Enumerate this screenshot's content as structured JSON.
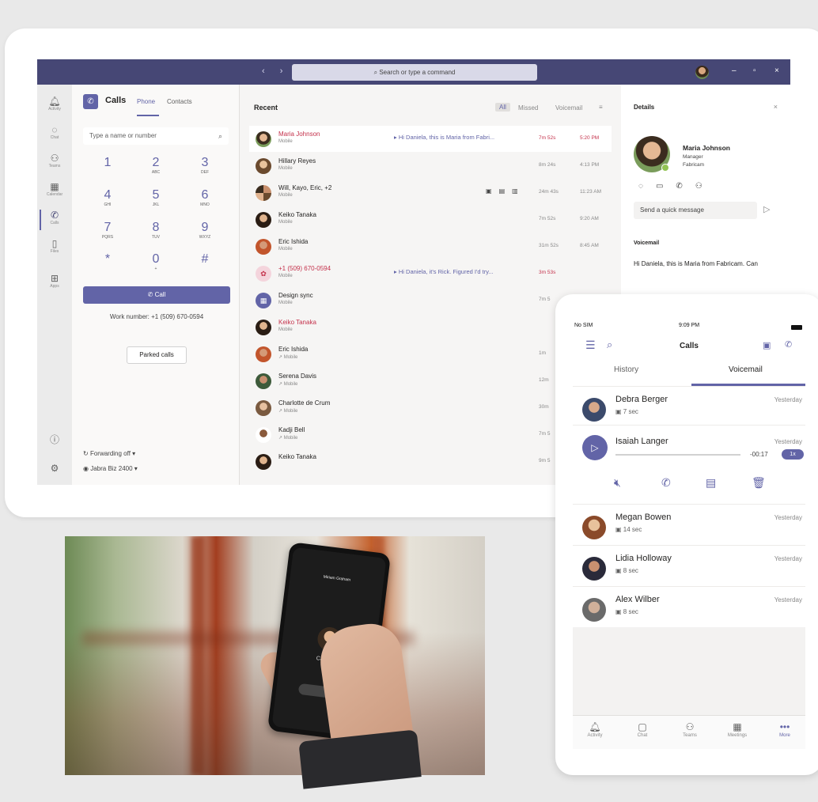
{
  "desktop": {
    "search": {
      "placeholder": "Search or type a command"
    },
    "nav_arrows": "‹  ›",
    "window_controls": {
      "minimize": "–",
      "maximize": "▫",
      "close": "×"
    },
    "rail": [
      {
        "label": "Activity",
        "icon": "bell-icon"
      },
      {
        "label": "Chat",
        "icon": "chat-icon"
      },
      {
        "label": "Teams",
        "icon": "teams-icon"
      },
      {
        "label": "Calendar",
        "icon": "calendar-icon"
      },
      {
        "label": "Calls",
        "icon": "phone-icon"
      },
      {
        "label": "Files",
        "icon": "file-icon"
      },
      {
        "label": "Apps",
        "icon": "apps-icon"
      }
    ],
    "dialer": {
      "title": "Calls",
      "tab_phone": "Phone",
      "tab_contacts": "Contacts",
      "input_placeholder": "Type a name or number",
      "keys": [
        {
          "d": "1",
          "l": ""
        },
        {
          "d": "2",
          "l": "ABC"
        },
        {
          "d": "3",
          "l": "DEF"
        },
        {
          "d": "4",
          "l": "GHI"
        },
        {
          "d": "5",
          "l": "JKL"
        },
        {
          "d": "6",
          "l": "MNO"
        },
        {
          "d": "7",
          "l": "PQRS"
        },
        {
          "d": "8",
          "l": "TUV"
        },
        {
          "d": "9",
          "l": "WXYZ"
        },
        {
          "d": "*",
          "l": ""
        },
        {
          "d": "0",
          "l": "+"
        },
        {
          "d": "#",
          "l": ""
        }
      ],
      "call_label": "Call",
      "work_number": "Work number: +1 (509) 670-0594",
      "parked_calls": "Parked calls",
      "forwarding": "Forwarding off",
      "device": "Jabra Biz 2400"
    },
    "recent": {
      "title": "Recent",
      "filters": [
        "All",
        "Missed",
        "Voicemail"
      ],
      "rows": [
        {
          "name": "Maria Johnson",
          "sub": "Mobile",
          "snippet": "Hi Daniela, this is Maria from Fabri...",
          "duration": "7m 52s",
          "time": "5:20 PM",
          "missed": true
        },
        {
          "name": "Hillary Reyes",
          "sub": "Mobile",
          "snippet": "",
          "duration": "8m 24s",
          "time": "4:13 PM",
          "missed": false
        },
        {
          "name": "Will, Kayo, Eric, +2",
          "sub": "Mobile",
          "snippet": "",
          "duration": "24m 43s",
          "time": "11:23 AM",
          "missed": false
        },
        {
          "name": "Keiko Tanaka",
          "sub": "Mobile",
          "snippet": "",
          "duration": "7m 52s",
          "time": "9:20 AM",
          "missed": false
        },
        {
          "name": "Eric Ishida",
          "sub": "Mobile",
          "snippet": "",
          "duration": "31m 52s",
          "time": "8:45 AM",
          "missed": false
        },
        {
          "name": "+1 (509) 670-0594",
          "sub": "Mobile",
          "snippet": "Hi Daniela, it's Rick. Figured I'd try...",
          "duration": "3m 53s",
          "time": "",
          "missed": true
        },
        {
          "name": "Design sync",
          "sub": "Mobile",
          "snippet": "",
          "duration": "7m 5",
          "time": "",
          "missed": false
        },
        {
          "name": "Keiko Tanaka",
          "sub": "Mobile",
          "snippet": "",
          "duration": "",
          "time": "",
          "missed": true
        },
        {
          "name": "Eric Ishida",
          "sub": "↗ Mobile",
          "snippet": "",
          "duration": "1m",
          "time": "",
          "missed": false
        },
        {
          "name": "Serena Davis",
          "sub": "↗ Mobile",
          "snippet": "",
          "duration": "12m",
          "time": "",
          "missed": false
        },
        {
          "name": "Charlotte de Crum",
          "sub": "↗ Mobile",
          "snippet": "",
          "duration": "30m",
          "time": "",
          "missed": false
        },
        {
          "name": "Kadji Bell",
          "sub": "↗ Mobile",
          "snippet": "",
          "duration": "7m 5",
          "time": "",
          "missed": false
        },
        {
          "name": "Keiko Tanaka",
          "sub": "",
          "snippet": "",
          "duration": "9m 5",
          "time": "",
          "missed": false
        }
      ]
    },
    "details": {
      "title": "Details",
      "name": "Maria Johnson",
      "role": "Manager",
      "org": "Fabricam",
      "quick_message": "Send a quick message",
      "voicemail_label": "Voicemail",
      "voicemail_text": "Hi Daniela, this is Maria from Fabricam. Can"
    }
  },
  "photo_phone": {
    "header": "Miriam Graham",
    "calling": "Calling..."
  },
  "mobile": {
    "carrier": "No SIM",
    "clock": "9:09 PM",
    "title": "Calls",
    "tab_history": "History",
    "tab_voicemail": "Voicemail",
    "voicemails": [
      {
        "name": "Debra Berger",
        "length": "7 sec",
        "when": "Yesterday"
      },
      {
        "name": "Isaiah Langer",
        "length": "",
        "when": "Yesterday"
      },
      {
        "name": "Megan Bowen",
        "length": "14 sec",
        "when": "Yesterday"
      },
      {
        "name": "Lidia Holloway",
        "length": "8 sec",
        "when": "Yesterday"
      },
      {
        "name": "Alex Wilber",
        "length": "8 sec",
        "when": "Yesterday"
      }
    ],
    "player": {
      "remaining": "-00:17",
      "speed": "1x",
      "progress": 0.0
    },
    "nav": [
      {
        "label": "Activity",
        "icon": "bell-icon"
      },
      {
        "label": "Chat",
        "icon": "chat-icon"
      },
      {
        "label": "Teams",
        "icon": "teams-icon"
      },
      {
        "label": "Meetings",
        "icon": "calendar-icon"
      },
      {
        "label": "More",
        "icon": "more-icon"
      }
    ]
  }
}
